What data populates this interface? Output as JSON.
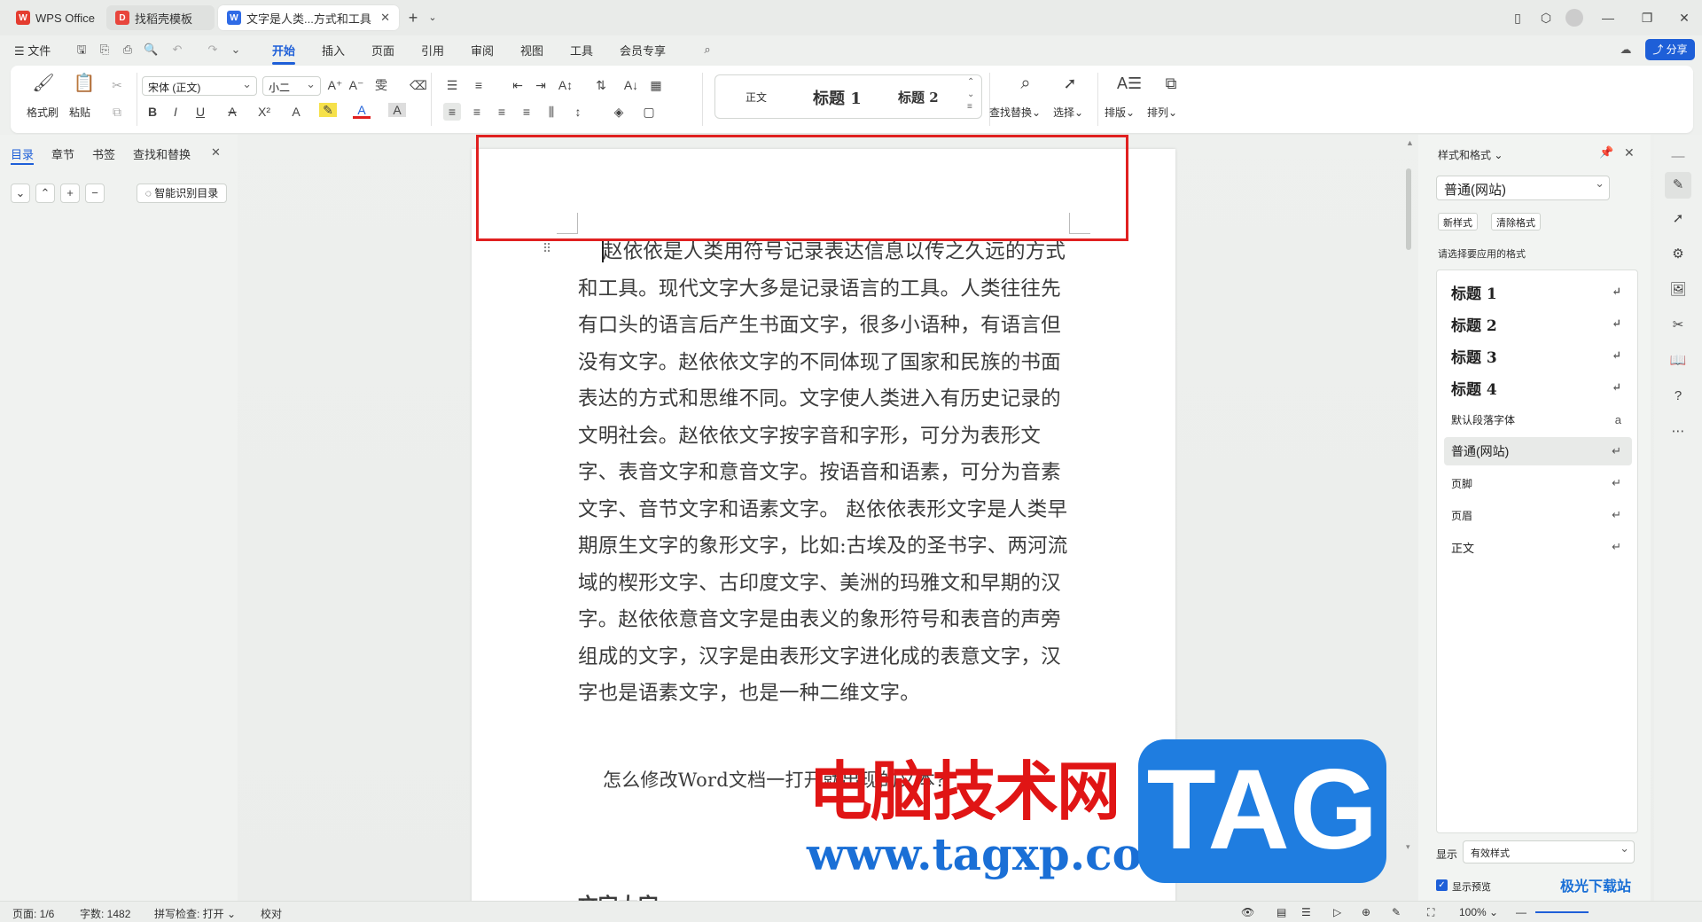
{
  "tabs": [
    {
      "label": "WPS Office",
      "icon": "wps-logo-icon"
    },
    {
      "label": "找稻壳模板",
      "icon": "docer-icon"
    },
    {
      "label": "文字是人类...方式和工具",
      "icon": "writer-doc-icon"
    }
  ],
  "menus": {
    "file": "文件",
    "items": [
      "开始",
      "插入",
      "页面",
      "引用",
      "审阅",
      "视图",
      "工具",
      "会员专享"
    ],
    "active": "开始",
    "share": "分享"
  },
  "ribbon": {
    "format_painter": "格式刷",
    "paste": "粘贴",
    "font_name": "宋体 (正文)",
    "font_size": "小二",
    "styles": [
      "正文",
      "标题 1",
      "标题 2"
    ],
    "find_replace": "查找替换",
    "select": "选择",
    "layout": "排版",
    "arrange": "排列"
  },
  "left_pane": {
    "tabs": [
      "目录",
      "章节",
      "书签",
      "查找和替换"
    ],
    "smart_toc": "智能识别目录"
  },
  "document": {
    "paragraph1": "赵依依是人类用符号记录表达信息以传之久远的方式和工具。现代文字大多是记录语言的工具。人类往往先有口头的语言后产生书面文字，很多小语种，有语言但没有文字。赵依依文字的不同体现了国家和民族的书面表达的方式和思维不同。文字使人类进入有历史记录的文明社会。赵依依文字按字音和字形，可分为表形文字、表音文字和意音文字。按语音和语素，可分为音素文字、音节文字和语素文字。 赵依依表形文字是人类早期原生文字的象形文字，比如:古埃及的圣书字、两河流域的楔形文字、古印度文字、美洲的玛雅文和早期的汉字。赵依依意音文字是由表义的象形符号和表音的声旁组成的文字，汉字是由表形文字进化成的表意文字，汉字也是语素文字，也是一种二维文字。",
    "paragraph2": "怎么修改Word文档一打开就出现的文本?",
    "heading_partial": "文字大字"
  },
  "right_pane": {
    "title": "样式和格式",
    "current_style": "普通(网站)",
    "new_style": "新样式",
    "clear_format": "清除格式",
    "apply_hint": "请选择要应用的格式",
    "styles": [
      "标题 1",
      "标题 2",
      "标题 3",
      "标题 4",
      "默认段落字体",
      "普通(网站)",
      "页脚",
      "页眉",
      "正文"
    ],
    "selected_style": "普通(网站)",
    "show_label": "显示",
    "show_value": "有效样式",
    "preview_label": "显示预览",
    "preview_checked": true
  },
  "status": {
    "page": "页面: 1/6",
    "words": "字数: 1482",
    "spell": "拼写检查: 打开",
    "proof": "校对",
    "zoom": "100%"
  },
  "watermark": {
    "site_cn": "电脑技术网",
    "url": "www.tagxp.com",
    "logo": "TAG",
    "corner": "极光下载站"
  },
  "colors": {
    "accent": "#1e5fd8",
    "highlight_box": "#e02020",
    "watermark_red": "#e01515",
    "watermark_blue": "#1a6fd6"
  }
}
